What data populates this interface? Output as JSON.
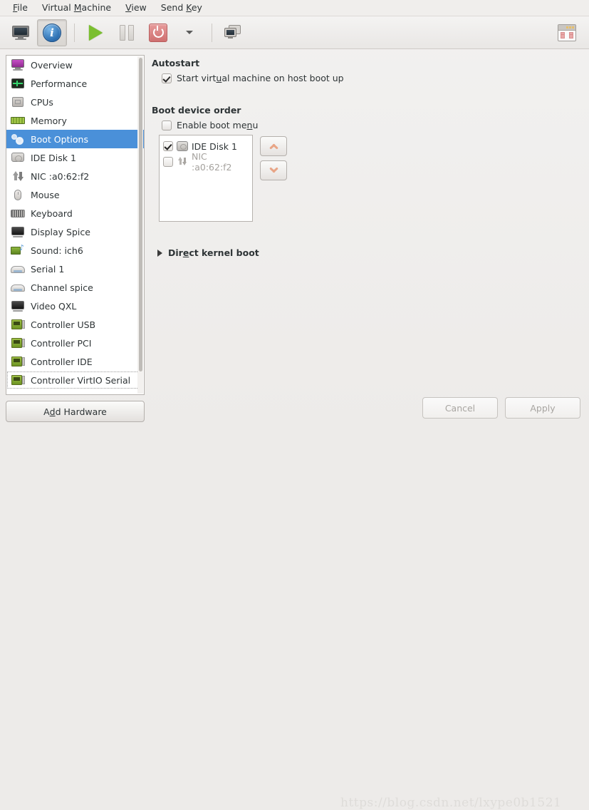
{
  "menubar": {
    "items": [
      {
        "pre": "",
        "key": "F",
        "post": "ile"
      },
      {
        "pre": "Virtual ",
        "key": "M",
        "post": "achine"
      },
      {
        "pre": "",
        "key": "V",
        "post": "iew"
      },
      {
        "pre": "Send ",
        "key": "K",
        "post": "ey"
      }
    ]
  },
  "toolbar": {
    "buttons": [
      {
        "name": "show-console-button",
        "icon": "monitor-icon",
        "state": "normal"
      },
      {
        "name": "show-details-button",
        "icon": "info-icon",
        "state": "pressed"
      },
      {
        "name": "run-button",
        "icon": "play-icon",
        "state": "normal"
      },
      {
        "name": "pause-button",
        "icon": "pause-icon",
        "state": "disabled"
      },
      {
        "name": "shutdown-button",
        "icon": "power-icon",
        "state": "normal"
      },
      {
        "name": "shutdown-menu-button",
        "icon": "caret-down-icon",
        "state": "normal"
      },
      {
        "name": "snapshots-button",
        "icon": "snapshot-icon",
        "state": "normal"
      },
      {
        "name": "fullscreen-button",
        "icon": "window-icon",
        "state": "normal"
      }
    ]
  },
  "sidebar": {
    "items": [
      {
        "label": "Overview",
        "icon": "monitor-icon",
        "selected": false
      },
      {
        "label": "Performance",
        "icon": "graph-icon",
        "selected": false
      },
      {
        "label": "CPUs",
        "icon": "cpu-icon",
        "selected": false
      },
      {
        "label": "Memory",
        "icon": "memory-icon",
        "selected": false
      },
      {
        "label": "Boot Options",
        "icon": "gears-icon",
        "selected": true
      },
      {
        "label": "IDE Disk 1",
        "icon": "disk-icon",
        "selected": false
      },
      {
        "label": "NIC :a0:62:f2",
        "icon": "network-icon",
        "selected": false
      },
      {
        "label": "Mouse",
        "icon": "mouse-icon",
        "selected": false
      },
      {
        "label": "Keyboard",
        "icon": "keyboard-icon",
        "selected": false
      },
      {
        "label": "Display Spice",
        "icon": "display-icon",
        "selected": false
      },
      {
        "label": "Sound: ich6",
        "icon": "sound-card-icon",
        "selected": false
      },
      {
        "label": "Serial 1",
        "icon": "serial-port-icon",
        "selected": false
      },
      {
        "label": "Channel spice",
        "icon": "serial-port-icon",
        "selected": false
      },
      {
        "label": "Video QXL",
        "icon": "display-icon",
        "selected": false
      },
      {
        "label": "Controller USB",
        "icon": "controller-icon",
        "selected": false
      },
      {
        "label": "Controller PCI",
        "icon": "controller-icon",
        "selected": false
      },
      {
        "label": "Controller IDE",
        "icon": "controller-icon",
        "selected": false
      },
      {
        "label": "Controller VirtIO Serial",
        "icon": "controller-icon",
        "selected": false
      }
    ],
    "add_hardware": {
      "pre": "A",
      "key": "d",
      "post": "d Hardware"
    }
  },
  "main": {
    "autostart": {
      "heading": "Autostart",
      "checkbox": {
        "pre": "Start virt",
        "key": "u",
        "post": "al machine on host boot up",
        "checked": true
      }
    },
    "boot_device_order": {
      "heading": "Boot device order",
      "enable_boot_menu": {
        "pre": "Enable boot me",
        "key": "n",
        "post": "u",
        "checked": false
      },
      "devices": [
        {
          "label": "IDE Disk 1",
          "icon": "disk-icon",
          "checked": true,
          "enabled": true
        },
        {
          "label": "NIC :a0:62:f2",
          "icon": "network-icon",
          "checked": false,
          "enabled": false
        }
      ],
      "move_up": "move-up-button",
      "move_down": "move-down-button"
    },
    "direct_kernel_boot": {
      "pre": "Dir",
      "key": "e",
      "post": "ct kernel boot",
      "expanded": false
    }
  },
  "footer": {
    "cancel_label": "Cancel",
    "apply_label": "Apply"
  },
  "watermark": {
    "text": "https://blog.csdn.net/lxype0b1521"
  },
  "colors": {
    "selection_blue": "#4a90d9",
    "window_bg": "#edebe9",
    "list_bg": "#ffffff",
    "arrow_salmon": "#e8a586",
    "power_red": "#cf6f6f",
    "play_green": "#7bbf2f"
  }
}
